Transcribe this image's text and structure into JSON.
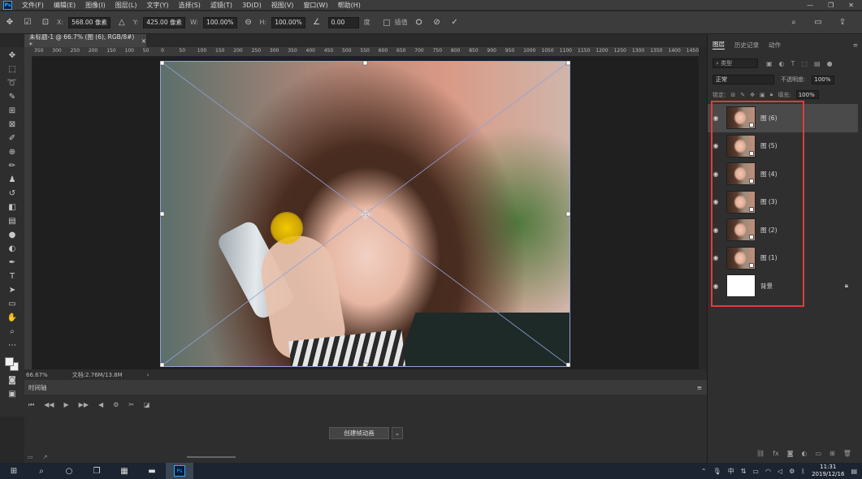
{
  "menubar": {
    "app_logo": "Ps",
    "items": [
      "文件(F)",
      "编辑(E)",
      "图像(I)",
      "图层(L)",
      "文字(Y)",
      "选择(S)",
      "滤镜(T)",
      "3D(D)",
      "视图(V)",
      "窗口(W)",
      "帮助(H)"
    ],
    "window_controls": [
      "—",
      "❐",
      "✕"
    ]
  },
  "options": {
    "x_label": "X:",
    "x_value": "568.00 像素",
    "y_label": "Y:",
    "y_value": "425.00 像素",
    "w_label": "W:",
    "w_value": "100.00%",
    "h_label": "H:",
    "h_value": "100.00%",
    "angle_value": "0.00",
    "angle_unit": "度",
    "interp_label": "插值",
    "right_icons": [
      "search-icon",
      "panel-icon",
      "share-icon"
    ]
  },
  "document": {
    "tab_title": "未标题-1 @ 66.7% (图 (6), RGB/8#) *",
    "ruler_ticks": [
      "350",
      "300",
      "250",
      "200",
      "150",
      "100",
      "50",
      "0",
      "50",
      "100",
      "150",
      "200",
      "250",
      "300",
      "350",
      "400",
      "450",
      "500",
      "550",
      "600",
      "650",
      "700",
      "750",
      "800",
      "850",
      "900",
      "950",
      "1000",
      "1050",
      "1100",
      "1150",
      "1200",
      "1250",
      "1300",
      "1350",
      "1400",
      "1450"
    ]
  },
  "status": {
    "zoom": "66.67%",
    "doc_size": "文档:2.76M/13.8M",
    "arrow": "›"
  },
  "timeline": {
    "title": "时间轴",
    "create_button": "创建帧动画",
    "dropdown_arrow": "⌄"
  },
  "panel": {
    "tabs": [
      "图层",
      "历史记录",
      "动作"
    ],
    "filter_label": "类型",
    "blend_mode": "正常",
    "opacity_label": "不透明度:",
    "opacity_value": "100%",
    "lock_label": "锁定:",
    "fill_label": "填充:",
    "fill_value": "100%",
    "layers": [
      {
        "name": "图 (6)",
        "selected": true,
        "smart": true
      },
      {
        "name": "图 (5)",
        "selected": false,
        "smart": true
      },
      {
        "name": "图 (4)",
        "selected": false,
        "smart": true
      },
      {
        "name": "图 (3)",
        "selected": false,
        "smart": true
      },
      {
        "name": "图 (2)",
        "selected": false,
        "smart": true
      },
      {
        "name": "图 (1)",
        "selected": false,
        "smart": true
      },
      {
        "name": "背景",
        "selected": false,
        "smart": false,
        "locked": true
      }
    ],
    "highlight_color": "#e33b3b"
  },
  "taskbar": {
    "time": "11:31",
    "date": "2019/12/16",
    "ps_label": "Ps",
    "ime_label": "中"
  },
  "colors": {
    "accent": "#31a8ff",
    "transform_lines": "#8fa3d9"
  }
}
